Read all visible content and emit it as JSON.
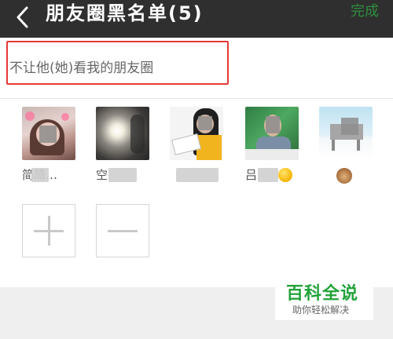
{
  "header": {
    "title": "朋友圈黑名单(5)",
    "done_label": "完成",
    "back_icon": "chevron-left-icon"
  },
  "section": {
    "title": "不让他(她)看我的朋友圈"
  },
  "members": [
    {
      "name": "简简…"
    },
    {
      "name": "空"
    },
    {
      "name": ""
    },
    {
      "name": "吕"
    },
    {
      "name": ""
    }
  ],
  "actions": {
    "add_icon": "plus-icon",
    "remove_icon": "minus-icon"
  },
  "watermark": {
    "title": "百科全说",
    "subtitle": "助你轻松解决"
  },
  "colors": {
    "topbar": "#2f2f2f",
    "done": "#2e8f3e",
    "highlight_border": "#e53935",
    "watermark_green": "#22a33a"
  }
}
